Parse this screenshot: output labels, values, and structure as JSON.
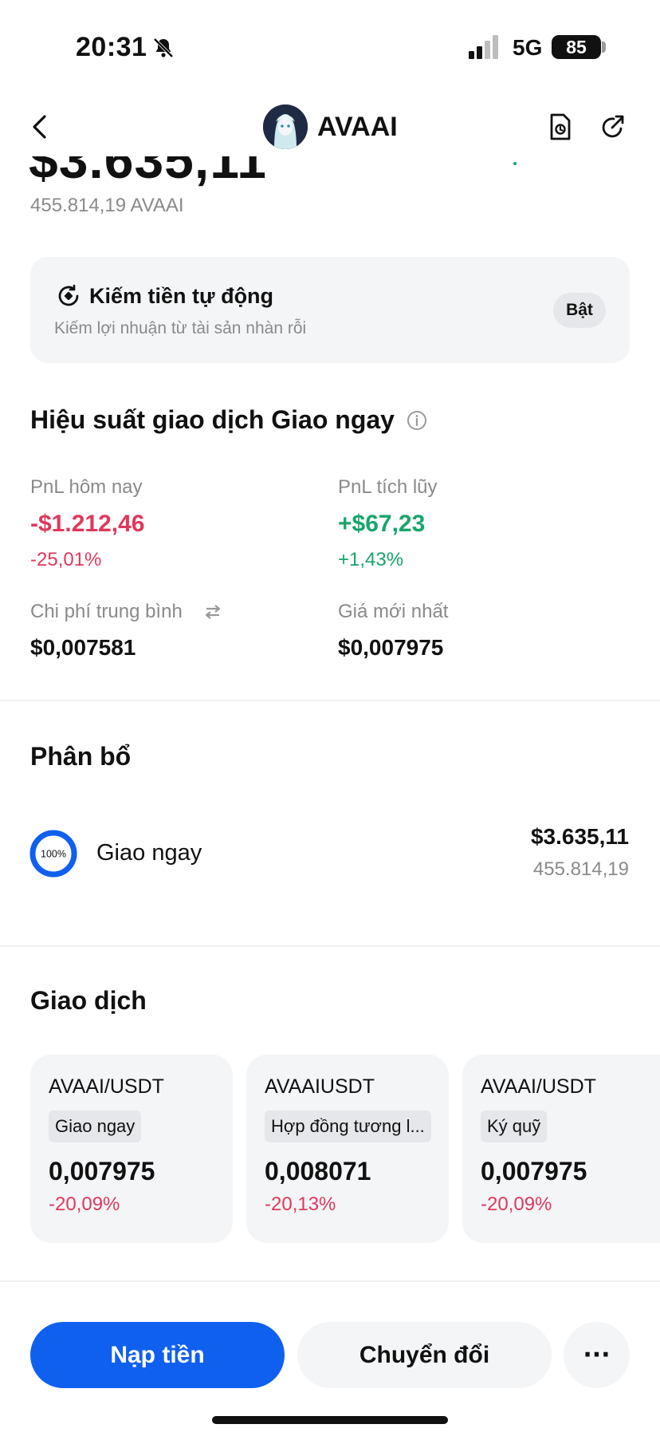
{
  "status_bar": {
    "time": "20:31",
    "network": "5G",
    "battery": "85",
    "bell_icon": "bell-slash-icon",
    "signal_icon": "cellular-signal-icon"
  },
  "header": {
    "title": "AVAAI",
    "back_icon": "chevron-left-icon",
    "history_icon": "document-clock-icon",
    "share_icon": "share-arrow-icon"
  },
  "balance": {
    "usd": "$3.635,11",
    "token_amount": "455.814,19 AVAAI"
  },
  "earn": {
    "title": "Kiếm tiền tự động",
    "subtitle": "Kiếm lợi nhuận từ tài sản nhàn rỗi",
    "button": "Bật"
  },
  "performance": {
    "title": "Hiệu suất giao dịch Giao ngay",
    "pnl_today_label": "PnL hôm nay",
    "pnl_today_value": "-$1.212,46",
    "pnl_today_pct": "-25,01%",
    "pnl_cum_label": "PnL tích lũy",
    "pnl_cum_value": "+$67,23",
    "pnl_cum_pct": "+1,43%",
    "avg_cost_label": "Chi phí trung bình",
    "avg_cost_value": "$0,007581",
    "last_price_label": "Giá mới nhất",
    "last_price_value": "$0,007975"
  },
  "allocation": {
    "title": "Phân bổ",
    "items": [
      {
        "percent_label": "100%",
        "percent": 100,
        "name": "Giao ngay",
        "usd": "$3.635,11",
        "amount": "455.814,19"
      }
    ]
  },
  "trade": {
    "title": "Giao dịch",
    "cards": [
      {
        "pair": "AVAAI/USDT",
        "type": "Giao ngay",
        "price": "0,007975",
        "change": "-20,09%"
      },
      {
        "pair": "AVAAIUSDT",
        "type": "Hợp đồng tương l...",
        "price": "0,008071",
        "change": "-20,13%"
      },
      {
        "pair": "AVAAI/USDT",
        "type": "Ký quỹ",
        "price": "0,007975",
        "change": "-20,09%"
      }
    ]
  },
  "bottom_bar": {
    "deposit": "Nạp tiền",
    "convert": "Chuyển đổi",
    "more": "···"
  },
  "colors": {
    "accent": "#1060f0",
    "negative": "#e0385c",
    "positive": "#18a56b",
    "card_bg": "#f4f5f7"
  }
}
